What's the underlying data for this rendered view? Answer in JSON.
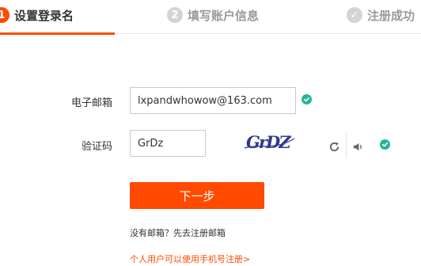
{
  "steps": [
    {
      "number": "1",
      "label": "设置登录名"
    },
    {
      "number": "2",
      "label": "填写账户信息"
    },
    {
      "number": "✓",
      "label": "注册成功"
    }
  ],
  "form": {
    "email_label": "电子邮箱",
    "email_value": "lxpandwhowow@163.com",
    "captcha_label": "验证码",
    "captcha_value": "GrDz",
    "captcha_image_text": "GrDZ",
    "next_button": "下一步"
  },
  "links": {
    "no_email": "没有邮箱？先去注册邮箱",
    "use_phone": "个人用户可以使用手机号注册>"
  },
  "colors": {
    "accent": "#ff4a00",
    "success": "#27b39a",
    "inactive": "#d4d4d4",
    "captcha_text": "#2f3a8f"
  },
  "icons": [
    "checkmark-icon",
    "refresh-icon",
    "speaker-icon"
  ]
}
